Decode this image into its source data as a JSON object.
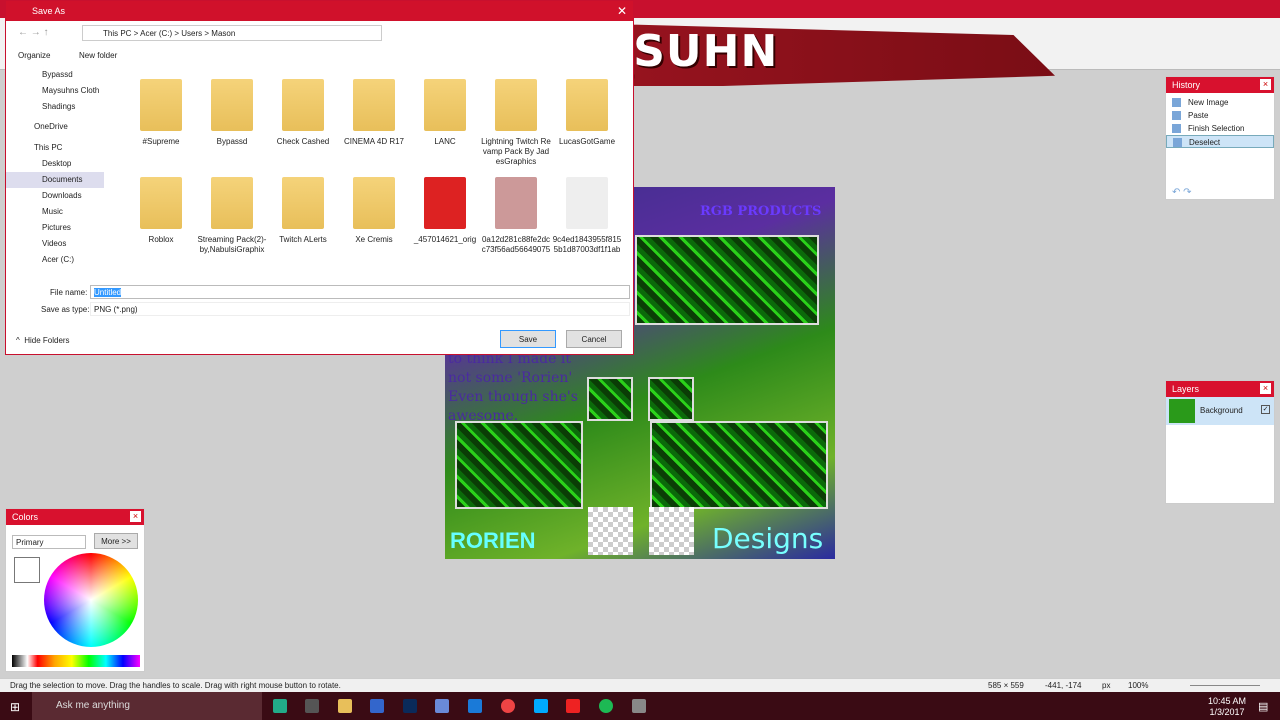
{
  "banner": {
    "title": "MAY_SUHN"
  },
  "dialog": {
    "title": "Save As",
    "breadcrumb": [
      "This PC",
      "Acer (C:)",
      "Users",
      "Mason"
    ],
    "organize": "Organize",
    "new_folder": "New folder",
    "tree": [
      {
        "label": "Bypassd"
      },
      {
        "label": "Maysuhns Cloth"
      },
      {
        "label": "Shadings"
      },
      {
        "label": "OneDrive"
      },
      {
        "label": "This PC"
      },
      {
        "label": "Desktop"
      },
      {
        "label": "Documents"
      },
      {
        "label": "Downloads"
      },
      {
        "label": "Music"
      },
      {
        "label": "Pictures"
      },
      {
        "label": "Videos"
      },
      {
        "label": "Acer (C:)"
      }
    ],
    "files": [
      {
        "name": "#Supreme"
      },
      {
        "name": "Bypassd"
      },
      {
        "name": "Check Cashed"
      },
      {
        "name": "CINEMA 4D R17"
      },
      {
        "name": "LANC"
      },
      {
        "name": "Lightning Twitch Revamp Pack By JadesGraphics"
      },
      {
        "name": "LucasGotGame"
      },
      {
        "name": "Roblox"
      },
      {
        "name": "Streaming Pack(2)-by,NabulsiGraphix"
      },
      {
        "name": "Twitch ALerts"
      },
      {
        "name": "Xe Cremis"
      },
      {
        "name": "_457014621_orig"
      },
      {
        "name": "0a12d281c88fe2dcc73f56ad56649075"
      },
      {
        "name": "9c4ed1843955f8155b1d87003df1f1ab"
      }
    ],
    "file_name_label": "File name:",
    "file_name_value": "Untitled",
    "type_label": "Save as type:",
    "type_value": "PNG (*.png)",
    "save": "Save",
    "cancel": "Cancel",
    "hide_folders": "Hide Folders"
  },
  "canvas": {
    "rgb": "RGB PRODUCTS",
    "text": "to think I made it not some 'Rorien' Even though she's awesome.",
    "rorien": "RORIEN",
    "designs": "Designs"
  },
  "history": {
    "title": "History",
    "items": [
      "New Image",
      "Paste",
      "Finish Selection",
      "Deselect"
    ],
    "selected": "Deselect"
  },
  "layers": {
    "title": "Layers",
    "items": [
      "Background"
    ]
  },
  "colors": {
    "title": "Colors",
    "mode": "Primary",
    "more": "More >>"
  },
  "status": {
    "hint": "Drag the selection to move. Drag the handles to scale. Drag with right mouse button to rotate.",
    "size": "585 × 559",
    "pos": "-441, -174",
    "unit": "px",
    "zoom": "100%"
  },
  "taskbar": {
    "search": "Ask me anything",
    "time": "10:45 AM",
    "date": "1/3/2017"
  },
  "colors_accent": {
    "red": "#c8102e",
    "taskbar": "#3a0b14"
  }
}
